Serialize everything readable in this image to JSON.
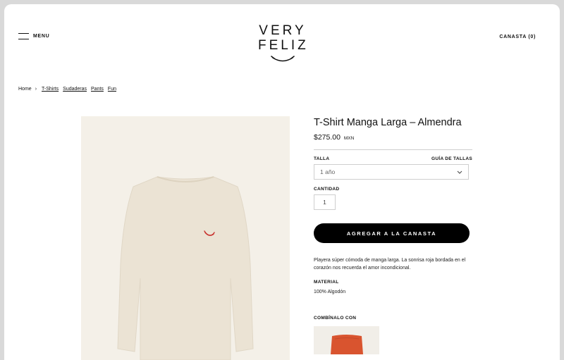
{
  "header": {
    "menu_label": "MENU",
    "logo_line1": "VERY",
    "logo_line2": "FELIZ",
    "cart_label": "CANASTA (0)"
  },
  "breadcrumb": {
    "home": "Home",
    "items": [
      "T-Shirts",
      "Sudaderas",
      "Pants",
      "Fun"
    ]
  },
  "product": {
    "title": "T-Shirt Manga Larga – Almendra",
    "price": "$275.00",
    "currency": "MXN",
    "size_label": "TALLA",
    "size_guide": "GUÍA DE TALLAS",
    "size_selected": "1 año",
    "quantity_label": "CANTIDAD",
    "quantity_value": "1",
    "add_button": "AGREGAR A LA CANASTA",
    "description": "Playera súper cómoda de manga larga. La sonrisa roja bordada en el corazón nos recuerda el amor incondicional.",
    "material_label": "MATERIAL",
    "material_value": "100% Algodón",
    "combine_label": "COMBÍNALO CON"
  },
  "colors": {
    "shirt": "#ebe3d4",
    "smile": "#c8302c",
    "pants": "#d9542f",
    "button": "#000000"
  }
}
